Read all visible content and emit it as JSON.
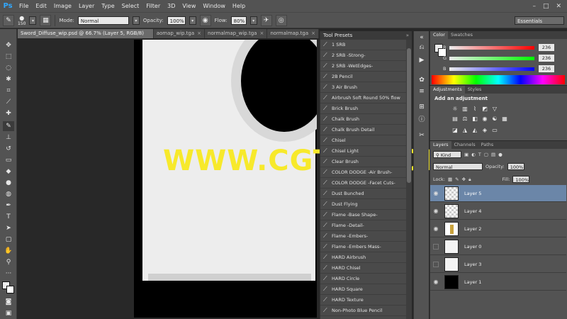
{
  "app": {
    "logo": "Ps",
    "menu": [
      "File",
      "Edit",
      "Image",
      "Layer",
      "Type",
      "Select",
      "Filter",
      "3D",
      "View",
      "Window",
      "Help"
    ],
    "window_controls": [
      "–",
      "□",
      "✕"
    ]
  },
  "options_bar": {
    "brush_size": "150",
    "mode_label": "Mode:",
    "mode_value": "Normal",
    "opacity_label": "Opacity:",
    "opacity_value": "100%",
    "flow_label": "Flow:",
    "flow_value": "80%",
    "workspace": "Essentials"
  },
  "document_tabs": [
    {
      "label": "Sword_Diffuse_wip.psd @ 66.7% (Layer 5, RGB/8) *",
      "active": true
    },
    {
      "label": "aomap_wip.tga",
      "active": false
    },
    {
      "label": "normalmap_wip.tga",
      "active": false
    },
    {
      "label": "normalmap.tga",
      "active": false
    }
  ],
  "canvas": {
    "watermark": "WWW.CGTSJ.COM"
  },
  "tool_presets": {
    "title": "Tool Presets",
    "items": [
      "1 SRB",
      "2 SRB -Strong-",
      "2 SRB -WetEdges-",
      "2B Pencil",
      "3 Air Brush",
      "Airbrush Soft Round 50% flow",
      "Brick Brush",
      "Chalk Brush",
      "Chalk Brush Detail",
      "Chisel",
      "Chisel Light",
      "Clear Brush",
      "COLOR DODGE -Air Brush-",
      "COLOR DODGE -Facet Cuts-",
      "Dust Bunched",
      "Dust Flying",
      "Flame -Base Shape-",
      "Flame -Detail-",
      "Flame -Embers-",
      "Flame -Embers Mass-",
      "HARD Airbrush",
      "HARD Chisel",
      "HARD Circle",
      "HARD Square",
      "HARD Texture",
      "Non-Photo Blue Pencil"
    ]
  },
  "color_panel": {
    "tabs": [
      "Color",
      "Swatches"
    ],
    "channels": [
      {
        "name": "R",
        "value": "236",
        "gradient": "#ff0000"
      },
      {
        "name": "G",
        "value": "236",
        "gradient": "#00ff00"
      },
      {
        "name": "B",
        "value": "236",
        "gradient": "#0000ff"
      }
    ]
  },
  "adjustments_panel": {
    "tabs": [
      "Adjustments",
      "Styles"
    ],
    "title": "Add an adjustment"
  },
  "layers_panel": {
    "tabs": [
      "Layers",
      "Channels",
      "Paths"
    ],
    "kind_label": "Kind",
    "blend_mode": "Normal",
    "opacity_label": "Opacity:",
    "opacity_value": "100%",
    "lock_label": "Lock:",
    "fill_label": "Fill:",
    "fill_value": "100%",
    "layers": [
      {
        "name": "Layer 5",
        "visible": true,
        "selected": true,
        "thumb": "checker"
      },
      {
        "name": "Layer 4",
        "visible": true,
        "selected": false,
        "thumb": "checker"
      },
      {
        "name": "Layer 2",
        "visible": true,
        "selected": false,
        "thumb": "lime"
      },
      {
        "name": "Layer 0",
        "visible": false,
        "selected": false,
        "thumb": "white"
      },
      {
        "name": "Layer 3",
        "visible": false,
        "selected": false,
        "thumb": "white"
      },
      {
        "name": "Layer 1",
        "visible": true,
        "selected": false,
        "thumb": "black"
      }
    ]
  }
}
